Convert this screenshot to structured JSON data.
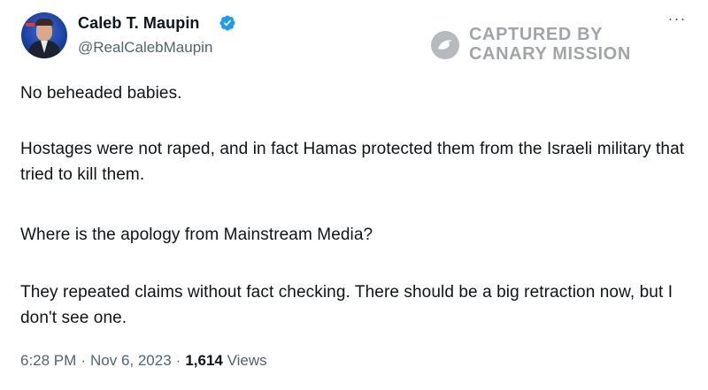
{
  "author": {
    "display_name": "Caleb T. Maupin",
    "handle": "@RealCalebMaupin",
    "verified": true
  },
  "watermark": {
    "line1": "CAPTURED BY",
    "line2": "CANARY MISSION"
  },
  "menu": {
    "more_label": "···"
  },
  "tweet": {
    "paragraphs": [
      "No beheaded babies.",
      "Hostages were not raped, and in fact Hamas protected them from the Israeli military that tried to kill them.",
      "Where is the apology from Mainstream Media?",
      "They repeated claims without fact checking. There should be a big retraction now, but I don't see one."
    ]
  },
  "meta": {
    "time": "6:28 PM",
    "date": "Nov 6, 2023",
    "separator": "·",
    "views_count": "1,614",
    "views_label": "Views"
  },
  "colors": {
    "verified_badge": "#1d9bf0",
    "secondary_text": "#536471",
    "primary_text": "#0f1419"
  },
  "icons": {
    "verified": "verified-badge-icon",
    "more": "more-options-icon",
    "watermark_logo": "canary-bird-icon"
  }
}
